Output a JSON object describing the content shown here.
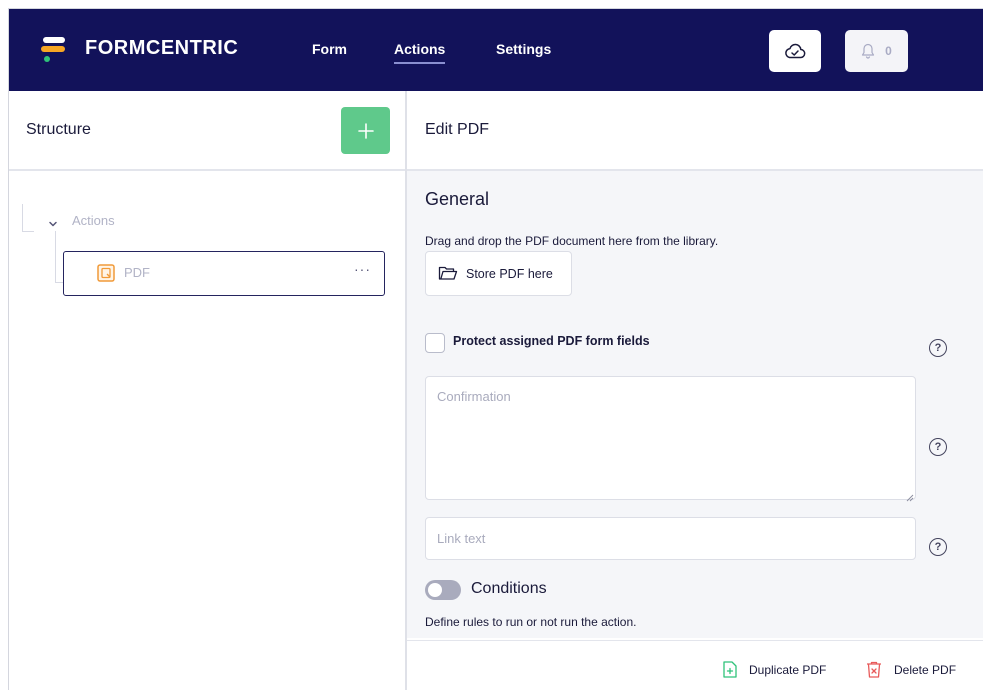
{
  "header": {
    "brand": "FORMCENTRIC",
    "nav": [
      {
        "label": "Form",
        "active": false
      },
      {
        "label": "Actions",
        "active": true
      },
      {
        "label": "Settings",
        "active": false
      }
    ],
    "cloud_icon": "cloud-check-icon",
    "bell_icon": "bell-icon",
    "notification_count": "0",
    "colors": {
      "nav_bg": "#12125a",
      "logo_orange": "#f7a624",
      "logo_green": "#2fc27a"
    }
  },
  "structure": {
    "title": "Structure",
    "add_icon": "plus-icon",
    "add_color": "#5fc98b",
    "tree": {
      "group_label": "Actions",
      "item_label": "PDF",
      "item_icon": "pdf-document-icon",
      "item_more": "···"
    }
  },
  "editor": {
    "title": "Edit PDF",
    "section_title": "General",
    "drag_instruction": "Drag and drop the PDF document here from the library.",
    "store_button": "Store PDF here",
    "protect_label": "Protect assigned PDF form fields",
    "protect_checked": false,
    "help_icon": "question-mark-icon",
    "help_glyph": "?",
    "confirmation": {
      "placeholder": "Confirmation",
      "value": ""
    },
    "link_text": {
      "placeholder": "Link text",
      "value": ""
    },
    "conditions": {
      "label": "Conditions",
      "enabled": false,
      "description": "Define rules to run or not run the action."
    },
    "footer": {
      "duplicate_label": "Duplicate PDF",
      "delete_label": "Delete PDF",
      "duplicate_color": "#2fc27a",
      "delete_color": "#e85a5a"
    }
  }
}
